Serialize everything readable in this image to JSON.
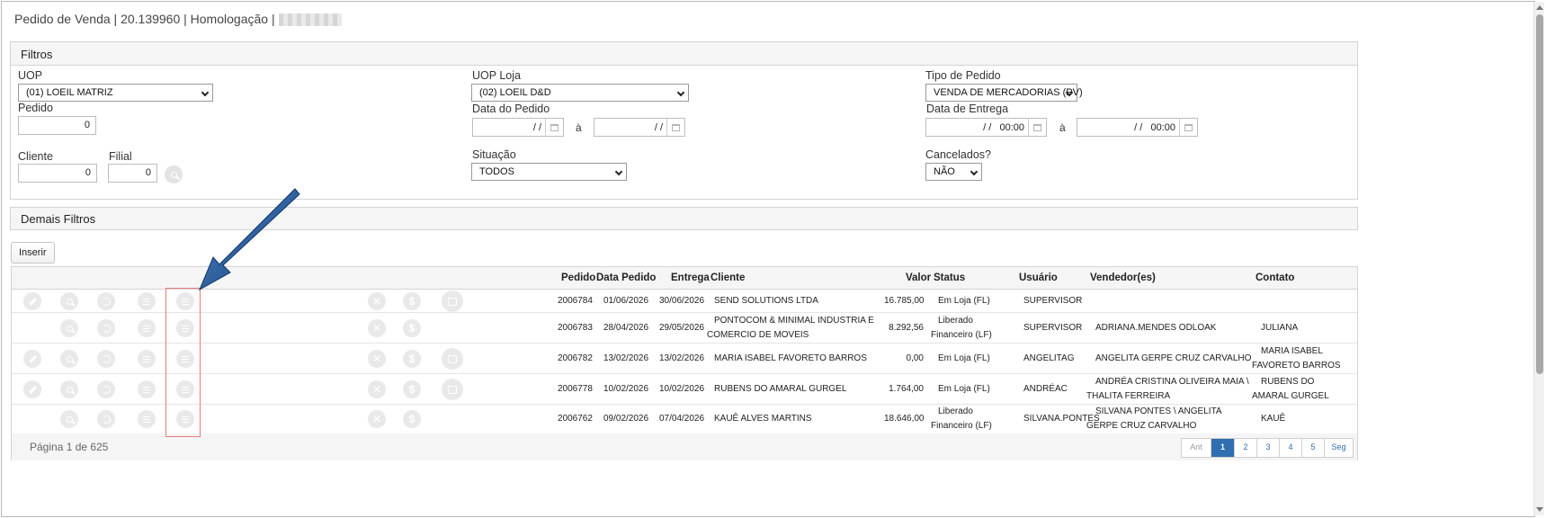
{
  "header": {
    "title": "Pedido de Venda | 20.139960 | Homologação |"
  },
  "filtros": {
    "title": "Filtros",
    "uop_label": "UOP",
    "uop_value": "(01) LOEIL MATRIZ",
    "uop_loja_label": "UOP Loja",
    "uop_loja_value": "(02) LOEIL D&D",
    "tipo_pedido_label": "Tipo de Pedido",
    "tipo_pedido_value": "VENDA DE MERCADORIAS (PV)",
    "pedido_label": "Pedido",
    "pedido_value": "0",
    "data_pedido_label": "Data do Pedido",
    "data_pedido_from": "/ /",
    "data_pedido_to": "/ /",
    "a_sep": "à",
    "data_entrega_label": "Data de Entrega",
    "data_entrega_from": "/ /   00:00",
    "data_entrega_to": "/ /   00:00",
    "cliente_label": "Cliente",
    "cliente_value": "0",
    "filial_label": "Filial",
    "filial_value": "0",
    "situacao_label": "Situação",
    "situacao_value": "TODOS",
    "cancelados_label": "Cancelados?",
    "cancelados_value": "NÃO"
  },
  "demais_filtros": {
    "title": "Demais Filtros"
  },
  "toolbar": {
    "inserir_label": "Inserir"
  },
  "table": {
    "columns": {
      "pedido": "Pedido",
      "data_pedido": "Data Pedido",
      "entrega": "Entrega",
      "cliente": "Cliente",
      "valor": "Valor",
      "status": "Status",
      "usuario": "Usuário",
      "vendedores": "Vendedor(es)",
      "contato": "Contato"
    },
    "rows": [
      {
        "pedido": "2006784",
        "data_pedido": "01/06/2026",
        "entrega": "30/06/2026",
        "cliente": "SEND SOLUTIONS LTDA",
        "valor": "16.785,00",
        "status": "Em Loja (FL)",
        "usuario": "SUPERVISOR",
        "vendedores": "",
        "contato": ""
      },
      {
        "pedido": "2006783",
        "data_pedido": "28/04/2026",
        "entrega": "29/05/2026",
        "cliente": "PONTOCOM & MINIMAL INDUSTRIA E COMERCIO DE MOVEIS",
        "valor": "8.292,56",
        "status": "Liberado Financeiro (LF)",
        "usuario": "SUPERVISOR",
        "vendedores": "ADRIANA.MENDES ODLOAK",
        "contato": "JULIANA"
      },
      {
        "pedido": "2006782",
        "data_pedido": "13/02/2026",
        "entrega": "13/02/2026",
        "cliente": "MARIA ISABEL FAVORETO BARROS",
        "valor": "0,00",
        "status": "Em Loja (FL)",
        "usuario": "ANGELITAG",
        "vendedores": "ANGELITA GERPE CRUZ CARVALHO",
        "contato": "MARIA ISABEL FAVORETO BARROS"
      },
      {
        "pedido": "2006778",
        "data_pedido": "10/02/2026",
        "entrega": "10/02/2026",
        "cliente": "RUBENS DO AMARAL GURGEL",
        "valor": "1.764,00",
        "status": "Em Loja (FL)",
        "usuario": "ANDRÉAC",
        "vendedores": "ANDRÉA CRISTINA OLIVEIRA MAIA \\ THALITA FERREIRA",
        "contato": "RUBENS DO AMARAL GURGEL"
      },
      {
        "pedido": "2006762",
        "data_pedido": "09/02/2026",
        "entrega": "07/04/2026",
        "cliente": "KAUÊ ALVES MARTINS",
        "valor": "18.646,00",
        "status": "Liberado Financeiro (LF)",
        "usuario": "SILVANA.PONTES",
        "vendedores": "SILVANA PONTES \\ ANGELITA GERPE CRUZ CARVALHO",
        "contato": "KAUÊ"
      }
    ]
  },
  "pagination": {
    "info": "Página 1 de 625",
    "prev": "Ant",
    "pages": [
      "1",
      "2",
      "3",
      "4",
      "5"
    ],
    "next": "Seg",
    "current": "1"
  },
  "icons": {
    "edit": "pencil-icon",
    "view": "magnifier-icon",
    "history": "history-icon",
    "list": "list-icon",
    "items": "list-icon",
    "cancel": "x-icon",
    "finance": "dollar-icon",
    "alter": "edit-icon"
  },
  "colors": {
    "accent": "#2f6eb0",
    "highlight": "#e87a7a",
    "annotation_arrow": "#1f4f8f"
  }
}
